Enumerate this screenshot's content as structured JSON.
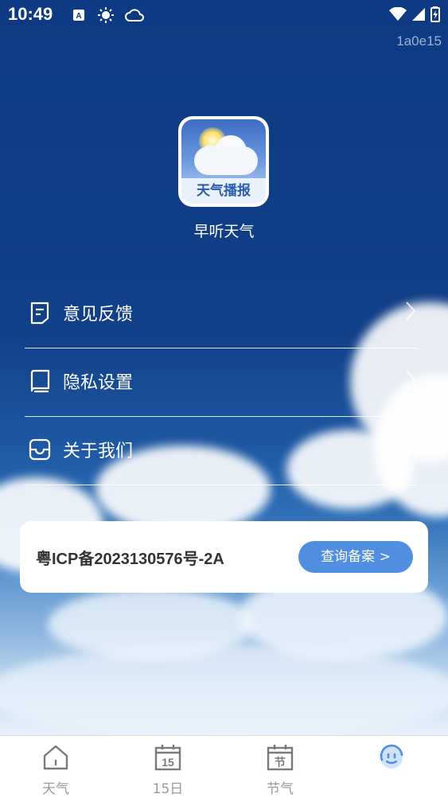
{
  "status_bar": {
    "time": "10:49",
    "icons": [
      "a-notification-icon",
      "sun-icon",
      "cloud-icon",
      "wifi-icon",
      "signal-icon",
      "battery-icon"
    ]
  },
  "build_id": "1a0e15",
  "app": {
    "icon_label": "天气播报",
    "name": "早听天气"
  },
  "menu": {
    "items": [
      {
        "label": "意见反馈",
        "icon": "feedback-icon"
      },
      {
        "label": "隐私设置",
        "icon": "book-icon"
      },
      {
        "label": "关于我们",
        "icon": "inbox-icon"
      }
    ]
  },
  "icp": {
    "text": "粤ICP备2023130576号-2A",
    "button_label": "查询备案 >"
  },
  "tabbar": {
    "items": [
      {
        "label": "天气",
        "icon": "home-icon"
      },
      {
        "label": "15日",
        "icon": "calendar-15-icon",
        "icon_text": "15"
      },
      {
        "label": "节气",
        "icon": "calendar-solar-term-icon",
        "icon_text": "节"
      },
      {
        "label": "",
        "icon": "smiley-icon"
      }
    ]
  },
  "colors": {
    "background_top": "#0d3a82",
    "accent_button": "#4f8ee0",
    "tab_inactive": "#9a9a9a",
    "tab_active": "#4f8ee0"
  }
}
